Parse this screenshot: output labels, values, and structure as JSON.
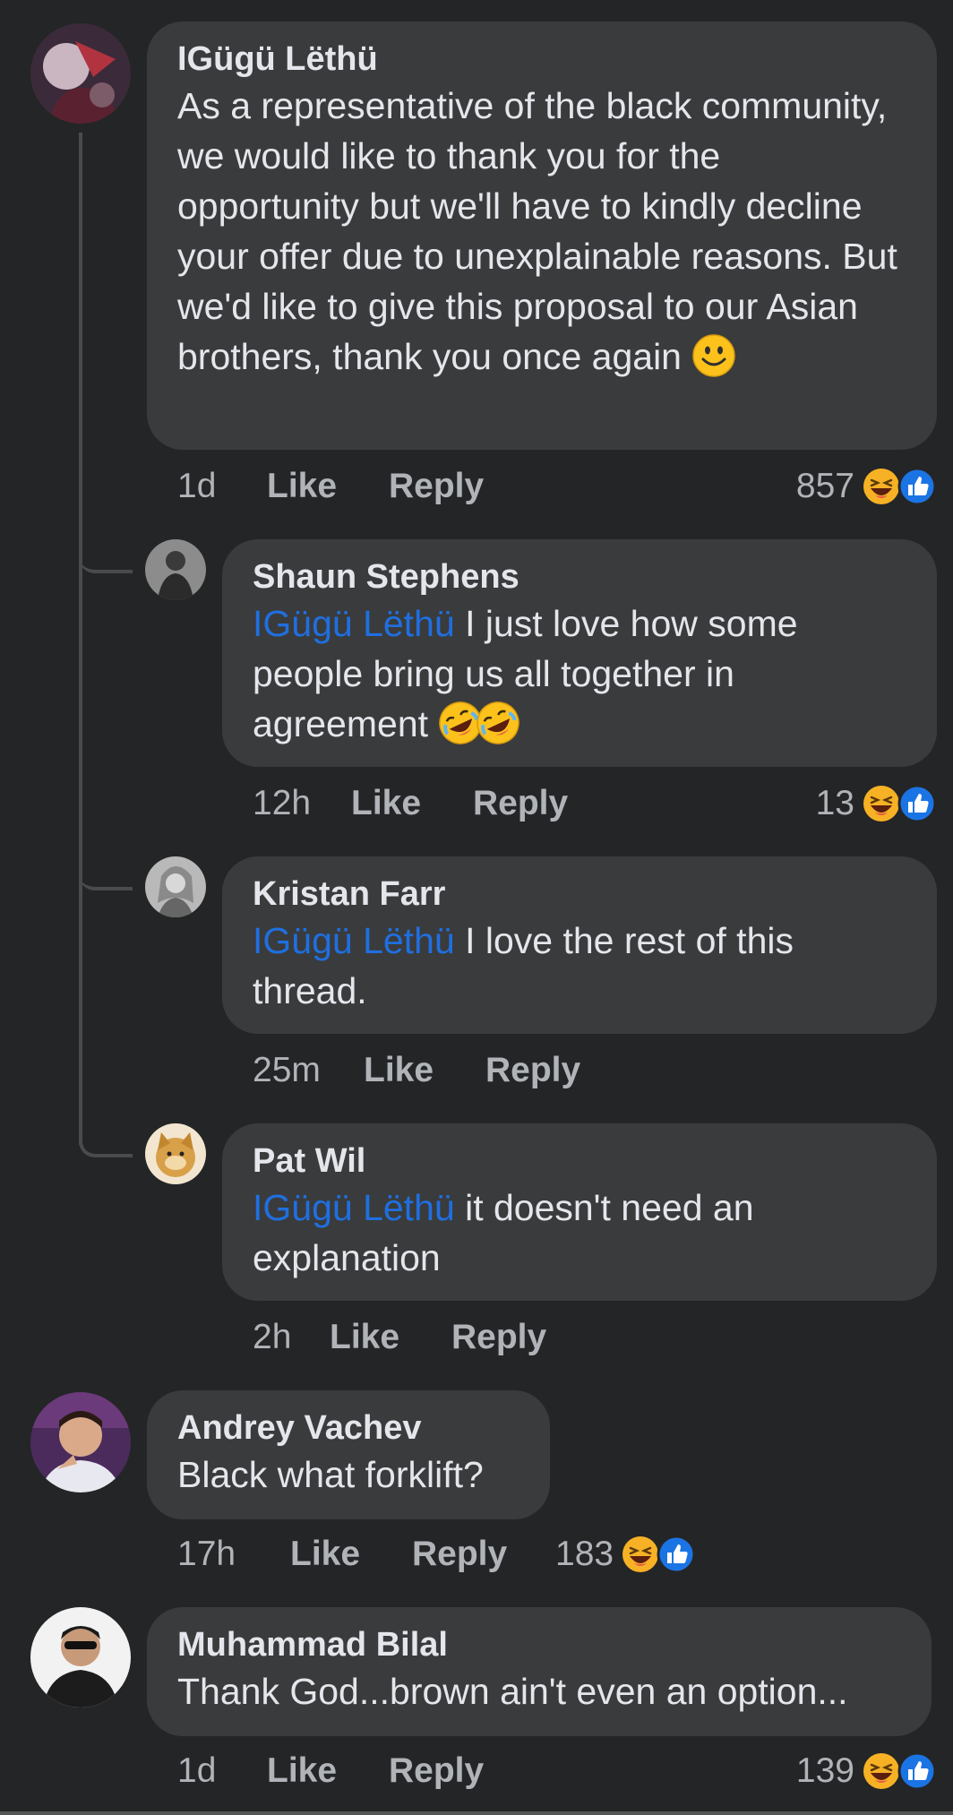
{
  "comments": [
    {
      "name": "IGügü Lëthü",
      "text": "As a representative of the black community, we would like to thank you for the opportunity but we'll have to kindly decline your offer due to unexplainable reasons. But we'd like to give this proposal to our Asian brothers, thank you once again",
      "time": "1d",
      "like": "Like",
      "reply": "Reply",
      "reactions": "857"
    },
    {
      "name": "Shaun Stephens",
      "mention": "IGügü Lëthü",
      "text": " I just love how some people bring us all together in agreement",
      "time": "12h",
      "like": "Like",
      "reply": "Reply",
      "reactions": "13"
    },
    {
      "name": "Kristan Farr",
      "mention": "IGügü Lëthü",
      "text": " I love the rest of this thread.",
      "time": "25m",
      "like": "Like",
      "reply": "Reply"
    },
    {
      "name": "Pat Wil",
      "mention": "IGügü Lëthü",
      "text": " it doesn't need an explanation",
      "time": "2h",
      "like": "Like",
      "reply": "Reply"
    },
    {
      "name": "Andrey Vachev",
      "text": "Black what forklift?",
      "time": "17h",
      "like": "Like",
      "reply": "Reply",
      "reactions": "183"
    },
    {
      "name": "Muhammad Bilal",
      "text": "Thank God...brown ain't even an option...",
      "time": "1d",
      "like": "Like",
      "reply": "Reply",
      "reactions": "139"
    }
  ],
  "colors": {
    "background": "#242526",
    "bubble": "#3a3b3c",
    "mention": "#1f6fe0",
    "like_blue": "#1b74e4",
    "haha_yellow": "#f7b125"
  },
  "icons": [
    "smile-emoji-icon",
    "rofl-emoji-icon",
    "haha-reaction-icon",
    "like-reaction-icon"
  ]
}
